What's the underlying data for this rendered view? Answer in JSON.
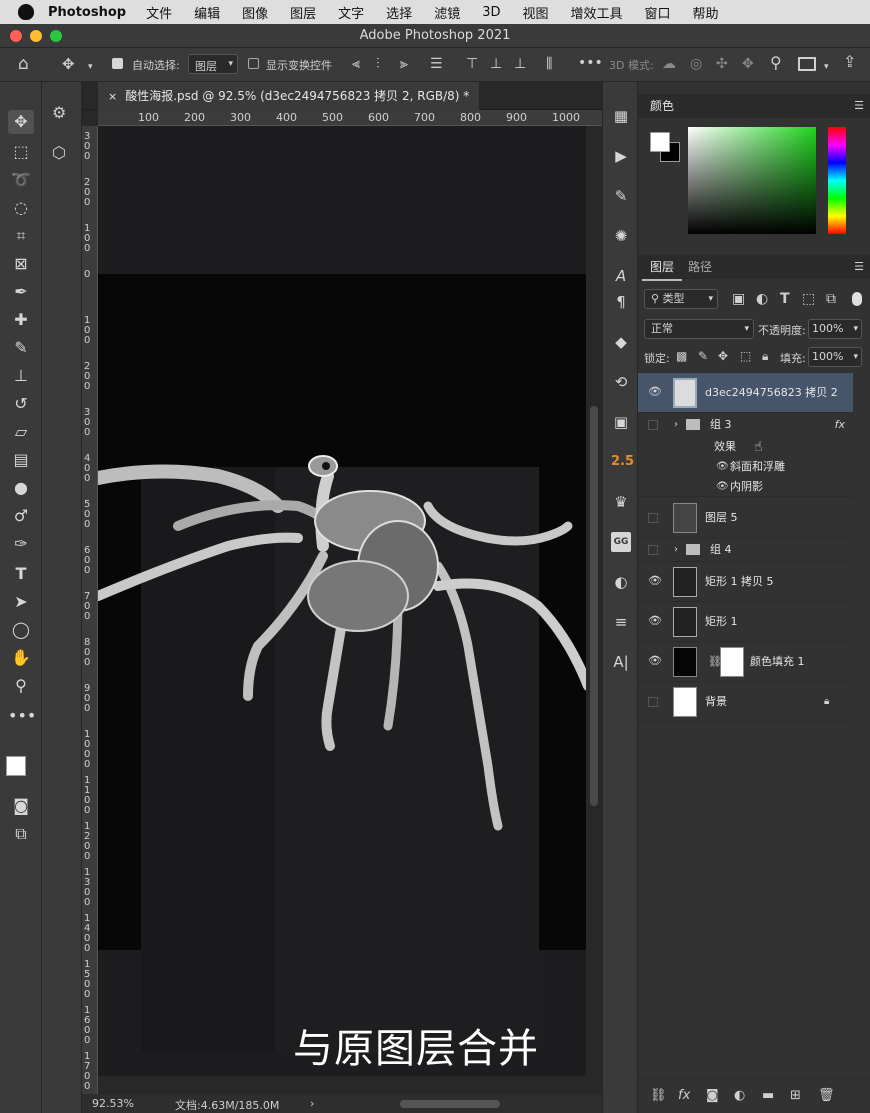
{
  "menubar": {
    "app_name": "Photoshop",
    "items": [
      "文件",
      "编辑",
      "图像",
      "图层",
      "文字",
      "选择",
      "滤镜",
      "3D",
      "视图",
      "增效工具",
      "窗口",
      "帮助"
    ]
  },
  "window": {
    "title": "Adobe Photoshop 2021"
  },
  "options": {
    "auto_select_label": "自动选择:",
    "auto_select_value": "图层",
    "show_transform_label": "显示变换控件",
    "mode_3d_label": "3D 模式:"
  },
  "document": {
    "tab_title": "酸性海报.psd @ 92.5% (d3ec2494756823 拷贝 2, RGB/8) *",
    "zoom": "92.53%",
    "doc_size": "文档:4.63M/185.0M",
    "caption": "与原图层合并",
    "ruler_marks": [
      "100",
      "200",
      "300",
      "400",
      "500",
      "600",
      "700",
      "800",
      "900",
      "1000"
    ],
    "vruler_marks": [
      "300",
      "200",
      "100",
      "0",
      "100",
      "200",
      "300",
      "400",
      "500",
      "600",
      "700",
      "800",
      "900",
      "1000",
      "1100",
      "1200",
      "1300",
      "1400",
      "1500",
      "1600",
      "1700"
    ]
  },
  "color_panel": {
    "tab": "颜色",
    "foreground": "#ffffff",
    "background": "#000000"
  },
  "layers_panel": {
    "tab_layers": "图层",
    "tab_paths": "路径",
    "filter_label": "类型",
    "blend_mode": "正常",
    "opacity_label": "不透明度:",
    "opacity_value": "100%",
    "lock_label": "锁定:",
    "fill_label": "填充:",
    "fill_value": "100%",
    "layers": [
      {
        "name": "d3ec2494756823 拷贝 2",
        "visible": true,
        "selected": true
      },
      {
        "name": "组 3",
        "visible": false,
        "group": true,
        "fx": "fx"
      },
      {
        "name": "效果",
        "sub": true
      },
      {
        "name": "斜面和浮雕",
        "sub": true,
        "effect": true
      },
      {
        "name": "内阴影",
        "sub": true,
        "effect": true
      },
      {
        "name": "图层 5",
        "visible": false
      },
      {
        "name": "组 4",
        "visible": false,
        "group": true
      },
      {
        "name": "矩形 1 拷贝 5",
        "visible": true
      },
      {
        "name": "矩形 1",
        "visible": true
      },
      {
        "name": "颜色填充 1",
        "visible": true
      },
      {
        "name": "背景",
        "visible": false,
        "locked": true
      }
    ]
  },
  "tools": {
    "zoom_indicator": "2.5"
  }
}
